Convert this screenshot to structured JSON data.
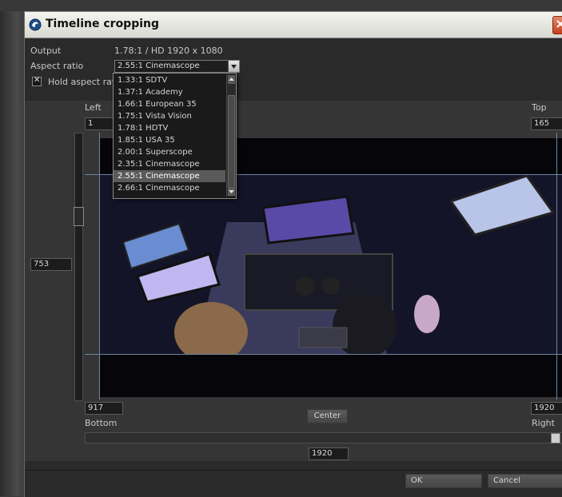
{
  "window": {
    "title": "Timeline cropping"
  },
  "output": {
    "label": "Output",
    "value": "1.78:1 / HD 1920 x 1080"
  },
  "aspect_ratio": {
    "label": "Aspect ratio",
    "selected": "2.55:1 Cinemascope",
    "options": [
      "1.33:1 SDTV",
      "1.37:1 Academy",
      "1.66:1 European 35",
      "1.75:1 Vista Vision",
      "1.78:1 HDTV",
      "1.85:1 USA 35",
      "2.00:1 Superscope",
      "2.35:1 Cinemascope",
      "2.55:1 Cinemascope",
      "2.66:1 Cinemascope"
    ]
  },
  "hold_aspect": {
    "label": "Hold aspect ratio",
    "checked": true
  },
  "crop": {
    "left_label": "Left",
    "left_value": "1",
    "top_label": "Top",
    "top_value": "165",
    "height_value": "753",
    "bottom_label": "Bottom",
    "bottom_value": "917",
    "right_label": "Right",
    "right_value": "1920",
    "width_value": "1920",
    "center_label": "Center"
  },
  "buttons": {
    "ok": "OK",
    "cancel": "Cancel"
  },
  "icons": {
    "title": "app-globe-icon",
    "close": "close-icon",
    "dropdown": "chevron-down-icon"
  },
  "colors": {
    "close_button": "#c4401c",
    "guide_lines": "#6c86a0"
  }
}
